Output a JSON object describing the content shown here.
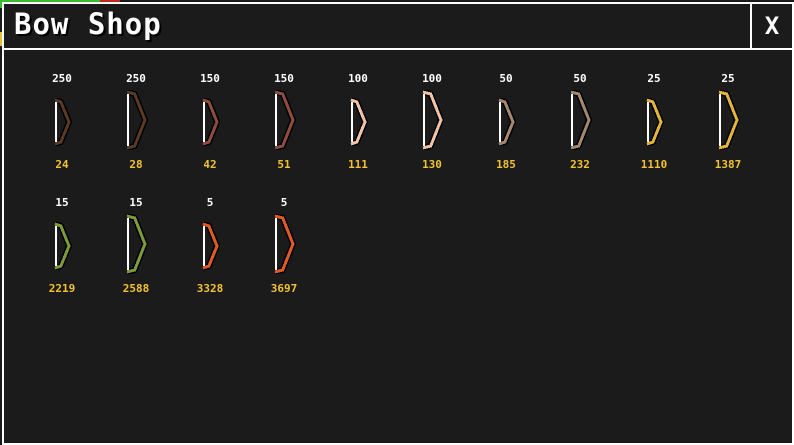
{
  "title": "Bow Shop",
  "close_label": "X",
  "colors": {
    "background": "#1b1b1b",
    "border": "#ffffff",
    "price": "#f2c232"
  },
  "items": [
    {
      "qty": "250",
      "price": "24",
      "color": "#5a3a22",
      "size": "small"
    },
    {
      "qty": "250",
      "price": "28",
      "color": "#5a3a22",
      "size": "large"
    },
    {
      "qty": "150",
      "price": "42",
      "color": "#8e4c3f",
      "size": "small"
    },
    {
      "qty": "150",
      "price": "51",
      "color": "#8e4c3f",
      "size": "large"
    },
    {
      "qty": "100",
      "price": "111",
      "color": "#f2c2a4",
      "size": "small"
    },
    {
      "qty": "100",
      "price": "130",
      "color": "#f2c2a4",
      "size": "large"
    },
    {
      "qty": "50",
      "price": "185",
      "color": "#a28870",
      "size": "small"
    },
    {
      "qty": "50",
      "price": "232",
      "color": "#a28870",
      "size": "large"
    },
    {
      "qty": "25",
      "price": "1110",
      "color": "#e2b43a",
      "size": "small"
    },
    {
      "qty": "25",
      "price": "1387",
      "color": "#e2b43a",
      "size": "large"
    },
    {
      "qty": "15",
      "price": "2219",
      "color": "#7e9a38",
      "size": "small"
    },
    {
      "qty": "15",
      "price": "2588",
      "color": "#7e9a38",
      "size": "large"
    },
    {
      "qty": "5",
      "price": "3328",
      "color": "#e05a28",
      "size": "small"
    },
    {
      "qty": "5",
      "price": "3697",
      "color": "#e05a28",
      "size": "large"
    }
  ]
}
